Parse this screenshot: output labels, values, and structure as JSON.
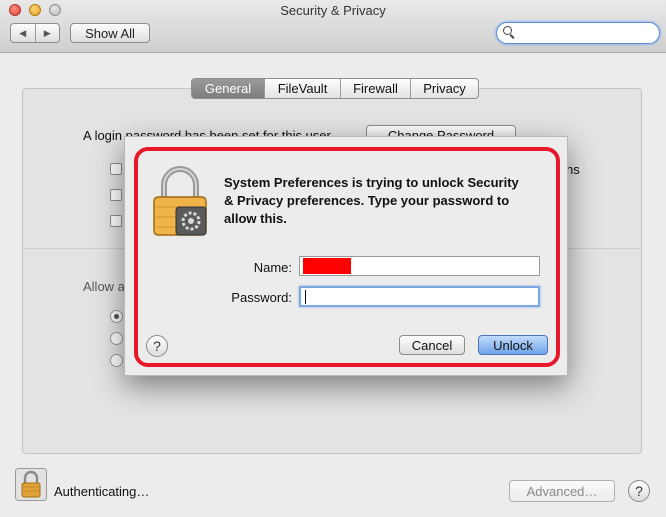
{
  "window": {
    "title": "Security & Privacy"
  },
  "toolbar": {
    "show_all": "Show All",
    "search_placeholder": ""
  },
  "tabs": [
    {
      "label": "General",
      "active": true
    },
    {
      "label": "FileVault",
      "active": false
    },
    {
      "label": "Firewall",
      "active": false
    },
    {
      "label": "Privacy",
      "active": false
    }
  ],
  "background": {
    "login_text": "A login password has been set for this user",
    "change_password": "Change Password",
    "checkbox_suffix": "ns",
    "allow_label": "Allow a"
  },
  "dialog": {
    "message": "System Preferences is trying to unlock Security & Privacy preferences. Type your password to allow this.",
    "name_label": "Name:",
    "name_value": "",
    "password_label": "Password:",
    "cancel": "Cancel",
    "unlock": "Unlock",
    "help": "?"
  },
  "status": {
    "authenticating": "Authenticating…",
    "advanced": "Advanced…",
    "help": "?"
  },
  "colors": {
    "highlight": "#e8182b",
    "redaction": "#ff0000",
    "default_button": "#6fa3ea"
  }
}
